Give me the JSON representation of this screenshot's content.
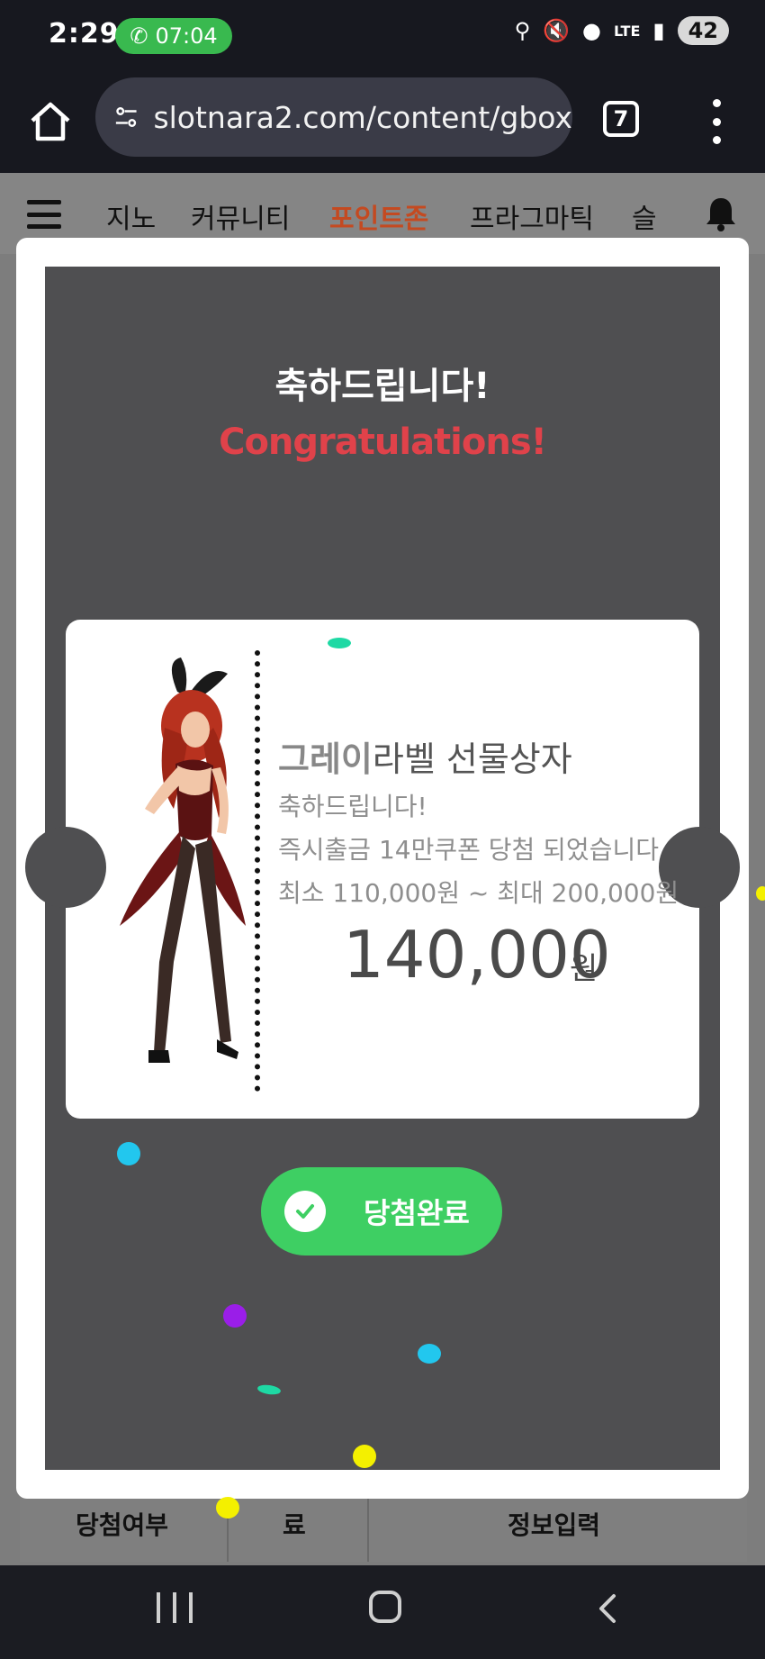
{
  "status_bar": {
    "time": "2:29",
    "call_timer": "07:04",
    "network": "LTE",
    "battery": "42"
  },
  "browser": {
    "url": "slotnara2.com/content/gbox",
    "tab_count": "7"
  },
  "site_nav": {
    "items": [
      "지노",
      "커뮤니티",
      "포인트존",
      "프라그마틱",
      "슬"
    ],
    "active_index": 2
  },
  "site_bottom_row": {
    "cells": [
      "당첨여부",
      "료",
      "정보입력"
    ]
  },
  "modal": {
    "heading_ko": "축하드립니다!",
    "heading_en": "Congratulations!",
    "ticket": {
      "title_highlight": "그레이",
      "title_rest": "라벨 선물상자",
      "line1": "축하드립니다!",
      "line2": "즉시출금 14만쿠폰 당첨 되었습니다",
      "line3": "최소 110,000원 ~ 최대 200,000원",
      "amount": "140,000",
      "amount_unit": "원"
    },
    "button_label": "당첨완료"
  },
  "colors": {
    "accent_green": "#3ecf63",
    "congrats_red": "#e0424a",
    "nav_active": "#c44a21"
  }
}
